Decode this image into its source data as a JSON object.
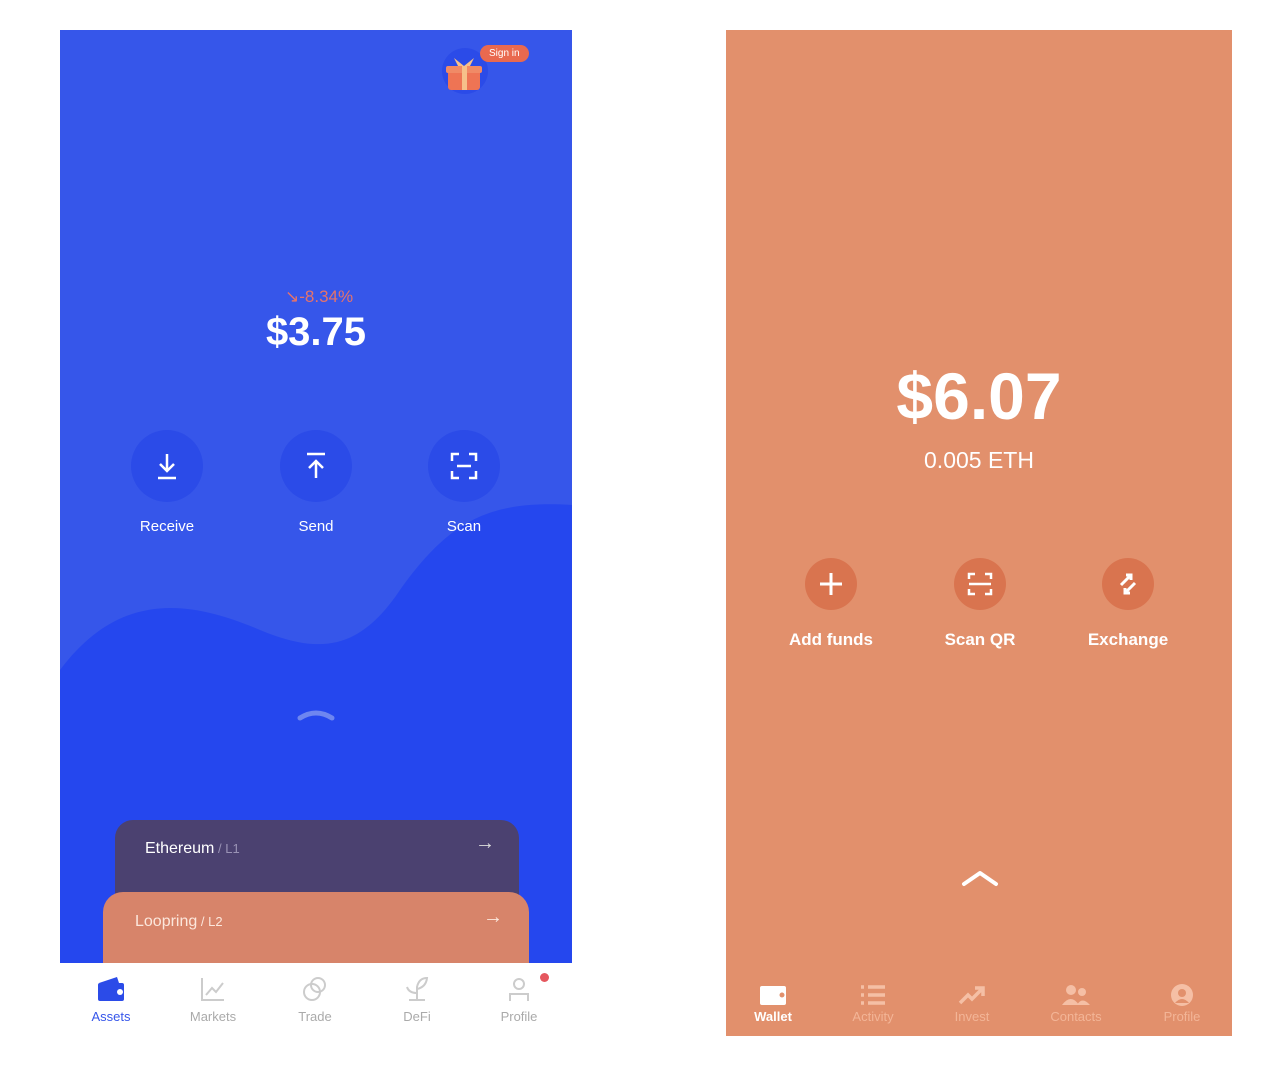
{
  "left": {
    "sign_in_badge": "Sign in",
    "change_percent": "-8.34%",
    "balance": "$3.75",
    "actions": [
      {
        "label": "Receive",
        "icon": "download-icon"
      },
      {
        "label": "Send",
        "icon": "upload-icon"
      },
      {
        "label": "Scan",
        "icon": "scan-icon"
      }
    ],
    "cards": [
      {
        "name": "Ethereum",
        "layer": " / L1",
        "color": "#4B4170"
      },
      {
        "name": "Loopring",
        "layer": " / L2",
        "color": "#D7846A"
      }
    ],
    "nav": [
      {
        "label": "Assets",
        "icon": "wallet-icon",
        "active": true
      },
      {
        "label": "Markets",
        "icon": "chart-icon",
        "active": false
      },
      {
        "label": "Trade",
        "icon": "trade-icon",
        "active": false
      },
      {
        "label": "DeFi",
        "icon": "sprout-icon",
        "active": false
      },
      {
        "label": "Profile",
        "icon": "user-icon",
        "active": false
      }
    ],
    "colors": {
      "background": "#3656EA",
      "accent": "#2B4BE8",
      "negative": "#E5736A"
    }
  },
  "right": {
    "balance": "$6.07",
    "eth_balance": "0.005 ETH",
    "actions": [
      {
        "label": "Add funds",
        "icon": "plus-icon"
      },
      {
        "label": "Scan QR",
        "icon": "scan-icon"
      },
      {
        "label": "Exchange",
        "icon": "exchange-icon"
      }
    ],
    "nav": [
      {
        "label": "Wallet",
        "icon": "wallet-icon",
        "active": true
      },
      {
        "label": "Activity",
        "icon": "list-icon",
        "active": false
      },
      {
        "label": "Invest",
        "icon": "trend-icon",
        "active": false
      },
      {
        "label": "Contacts",
        "icon": "contacts-icon",
        "active": false
      },
      {
        "label": "Profile",
        "icon": "profile-icon",
        "active": false
      }
    ],
    "colors": {
      "background": "#E2906C",
      "button": "#D9744F"
    }
  }
}
